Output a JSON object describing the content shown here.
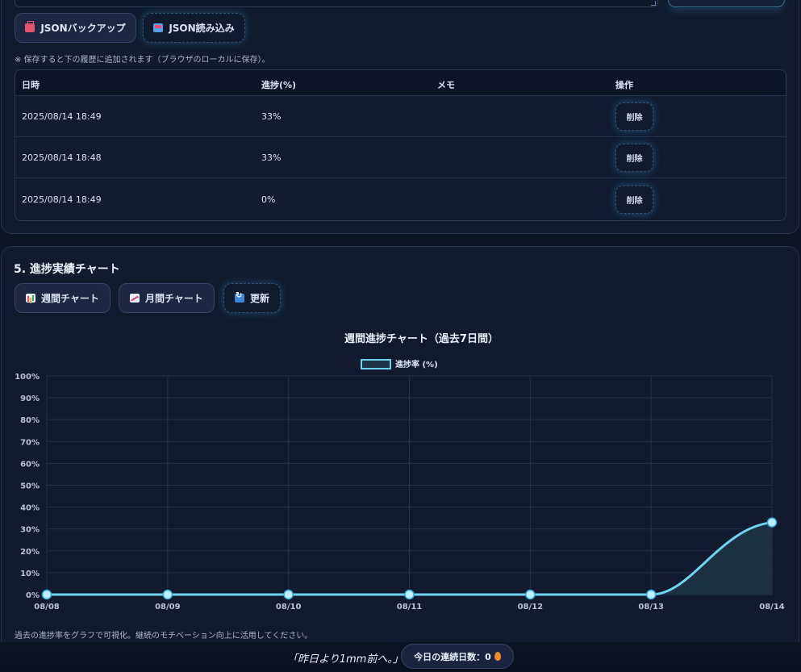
{
  "backup": {
    "export_label": "JSONバックアップ",
    "import_label": "JSON読み込み",
    "note": "※ 保存すると下の履歴に追加されます（ブラウザのローカルに保存）。"
  },
  "history": {
    "columns": [
      "日時",
      "進捗(%)",
      "メモ",
      "操作"
    ],
    "rows": [
      {
        "datetime": "2025/08/14 18:49",
        "progress": "33%",
        "memo": "",
        "action": "削除"
      },
      {
        "datetime": "2025/08/14 18:48",
        "progress": "33%",
        "memo": "",
        "action": "削除"
      },
      {
        "datetime": "2025/08/14 18:49",
        "progress": "0%",
        "memo": "",
        "action": "削除"
      }
    ]
  },
  "chart_section": {
    "title": "5. 進捗実績チャート",
    "weekly_label": "週間チャート",
    "monthly_label": "月間チャート",
    "refresh_label": "更新",
    "note": "過去の進捗率をグラフで可視化。継続のモチベーション向上に活用してください。"
  },
  "chart_data": {
    "type": "line",
    "title": "週間進捗チャート（過去7日間）",
    "x": [
      "08/08",
      "08/09",
      "08/10",
      "08/11",
      "08/12",
      "08/13",
      "08/14"
    ],
    "series": [
      {
        "name": "進捗率 (%)",
        "values": [
          0,
          0,
          0,
          0,
          0,
          0,
          33
        ]
      }
    ],
    "ylim": [
      0,
      100
    ],
    "yticks": [
      "0%",
      "10%",
      "20%",
      "30%",
      "40%",
      "50%",
      "60%",
      "70%",
      "80%",
      "90%",
      "100%"
    ],
    "grid": true,
    "legend": "top-center",
    "colors": {
      "line": "#6fd3f0",
      "fill": "#1f3548",
      "grid": "#26334b",
      "point": "#bfefff"
    }
  },
  "footer": {
    "tagline": "「昨日より1mm前へ。」",
    "streak_label": "今日の連続日数：0"
  }
}
